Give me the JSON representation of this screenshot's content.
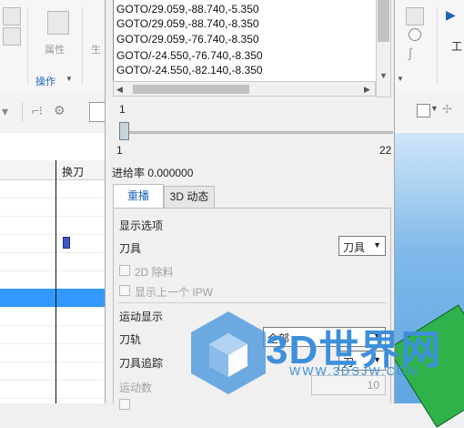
{
  "ribbon": {
    "attributes_label": "属性",
    "generate_label": "生",
    "operations_group": "操作",
    "work_label": "工"
  },
  "operation_list": {
    "column_header": "换刀"
  },
  "tool_path_lines": [
    "GOTO/29.059,-88.740,-5.350",
    "GOTO/29.059,-88.740,-8.350",
    "GOTO/29.059,-76.740,-8.350",
    "GOTO/-24.550,-76.740,-8.350",
    "GOTO/-24.550,-82.140,-8.350"
  ],
  "slider": {
    "current": "1",
    "min": "1",
    "max": "22",
    "value": 1
  },
  "feed_rate_text": "进给率 0.000000",
  "tabs": [
    "重播",
    "3D 动态"
  ],
  "display_options": {
    "section_title": "显示选项",
    "tool_label": "刀具",
    "tool_value": "刀具",
    "cut_2d_label": "2D 除料",
    "show_prev_ipw_label": "显示上一个 IPW"
  },
  "motion_display": {
    "section_title": "运动显示",
    "path_label": "刀轨",
    "path_value": "全部",
    "trace_label": "刀具追踪",
    "trace_value": "刀",
    "motion_count_label": "运动数",
    "motion_count_value": "10"
  },
  "watermark": {
    "title": "3D世界网",
    "url": "WWW.3DSJW.COM"
  },
  "colors": {
    "accent": "#1e63b6",
    "selection": "#3399ff",
    "watermark": "#3d8fdc"
  }
}
